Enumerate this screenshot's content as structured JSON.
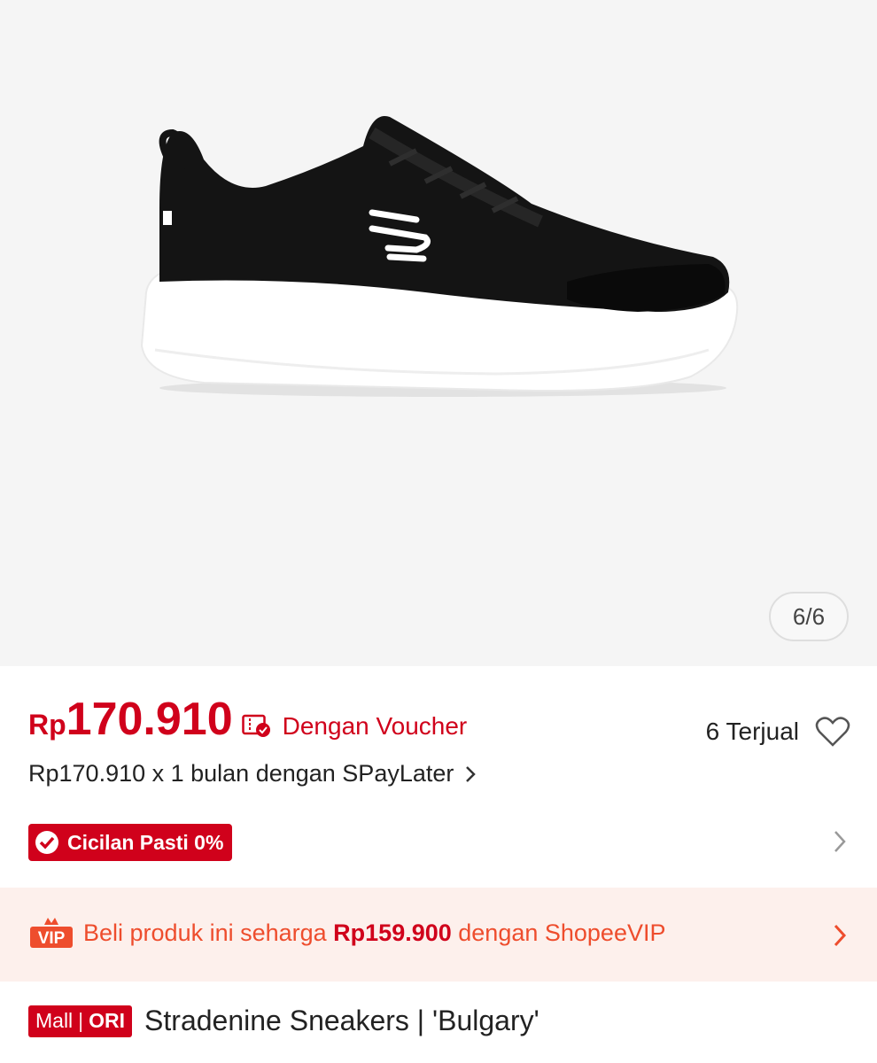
{
  "gallery": {
    "counter": "6/6",
    "image_icon": "sneaker-product-image"
  },
  "price": {
    "currency": "Rp",
    "amount": "170.910",
    "voucher_label": "Dengan Voucher",
    "sold": "6 Terjual",
    "paylater": "Rp170.910 x 1 bulan dengan SPayLater",
    "cicilan": "Cicilan Pasti 0%"
  },
  "vip": {
    "badge": "VIP",
    "text_prefix": "Beli produk ini seharga ",
    "text_price": "Rp159.900",
    "text_suffix": " dengan ShopeeVIP"
  },
  "product": {
    "mall": "Mall",
    "ori": "ORI",
    "title": "Stradenine Sneakers | 'Bulgary'"
  },
  "colors": {
    "accent": "#d0011b",
    "vip_orange": "#ee4d2d",
    "vip_bg": "#fdf0ec"
  }
}
